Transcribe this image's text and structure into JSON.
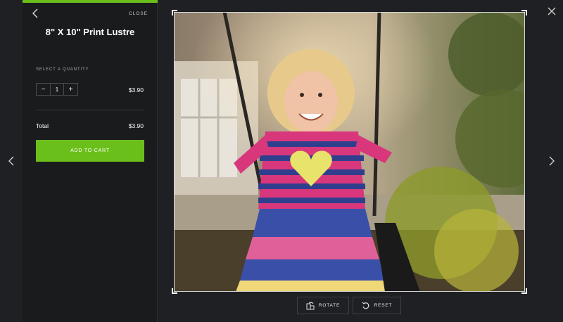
{
  "panel": {
    "close_label": "CLOSE",
    "product_title": "8\" X 10\" Print Lustre",
    "quantity_label": "SELECT A QUANTITY",
    "quantity_value": "1",
    "minus_glyph": "−",
    "plus_glyph": "+",
    "unit_price": "$3.90",
    "total_label": "Total",
    "total_value": "$3.90",
    "add_to_cart_label": "ADD TO CART"
  },
  "toolbar": {
    "rotate_label": "ROTATE",
    "reset_label": "RESET"
  },
  "icons": {
    "back": "chevron-left-icon",
    "prev": "chevron-left-icon",
    "next": "chevron-right-icon",
    "close": "close-icon",
    "rotate": "rotate-icon",
    "reset": "reset-icon"
  },
  "colors": {
    "accent": "#6bbf1a",
    "background": "#1f2023",
    "panel": "#1a1b1d"
  }
}
